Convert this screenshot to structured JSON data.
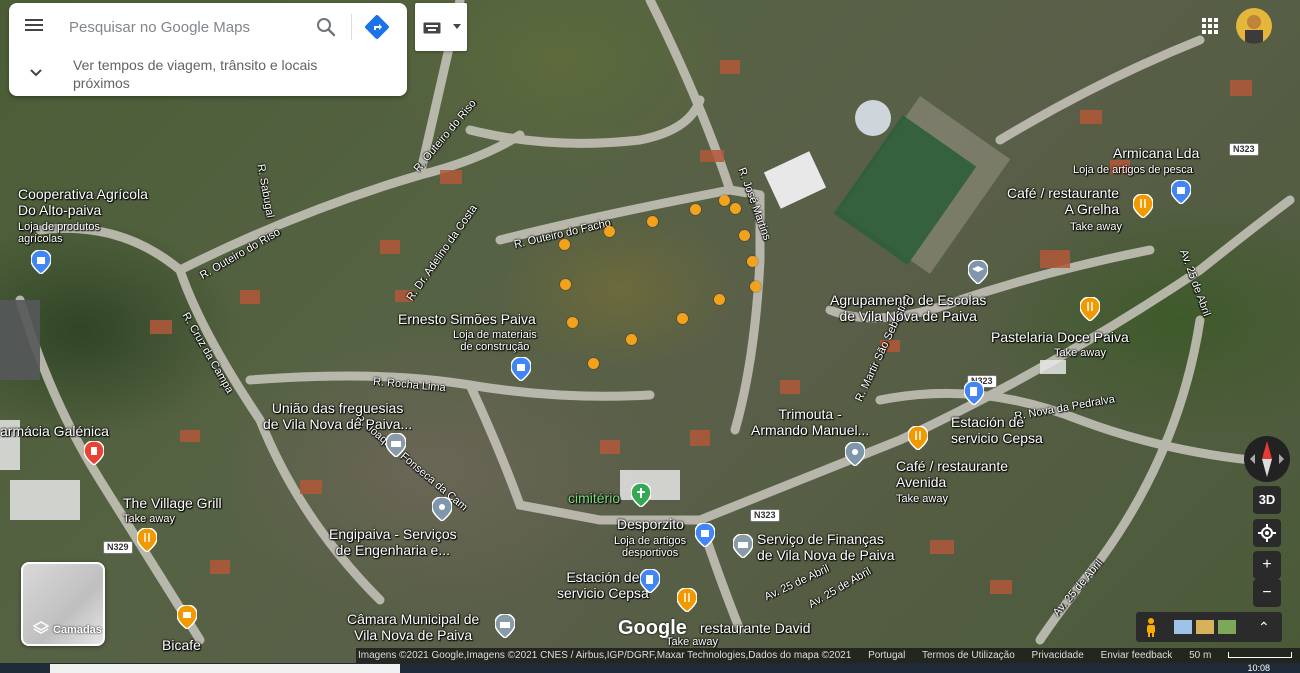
{
  "search": {
    "placeholder": "Pesquisar no Google Maps",
    "nearby_text": "Ver tempos de viagem, trânsito e locais próximos"
  },
  "icons": {
    "menu": "hamburger-icon",
    "search": "search-icon",
    "directions": "directions-icon",
    "keyboard": "keyboard-icon",
    "apps": "apps-grid-icon",
    "layers": "layers-icon",
    "pegman": "pegman-icon"
  },
  "layers": {
    "label": "Camadas"
  },
  "controls": {
    "three_d": "3D",
    "zoom_in": "+",
    "zoom_out": "−",
    "expand": "⌃"
  },
  "places": [
    {
      "name": "Cooperativa Agrícola\nDo Alto-paiva",
      "sub": "Loja de produtos\nagrícolas"
    },
    {
      "name": "Ernesto Simões Paiva",
      "sub": "Loja de materiais\nde construção"
    },
    {
      "name": "União das freguesias\nde Vila Nova de Paiva..."
    },
    {
      "name": "armácia Galénica"
    },
    {
      "name": "The Village Grill",
      "sub": "Take away"
    },
    {
      "name": "Engipaiva - Serviços\nde Engenharia e..."
    },
    {
      "name": "Câmara Municipal de\nVila Nova de Paiva"
    },
    {
      "name": "Bicafe"
    },
    {
      "name": "cimitério"
    },
    {
      "name": "Desporzito",
      "sub": "Loja de artigos\ndesportivos"
    },
    {
      "name": "Estación de\nservicio Cepsa"
    },
    {
      "name": "Serviço de Finanças\nde Vila Nova de Paiva"
    },
    {
      "name": "restaurante David",
      "sub": "Take away"
    },
    {
      "name": "Trimouta -\nArmando Manuel..."
    },
    {
      "name": "Agrupamento de Escolas\nde Vila Nova de Paiva"
    },
    {
      "name": "Pastelaria Doce Paiva",
      "sub": "Take away"
    },
    {
      "name": "Estación de\nservicio Cepsa"
    },
    {
      "name": "Café / restaurante\nAvenida",
      "sub": "Take away"
    },
    {
      "name": "Café / restaurante\nA Grelha",
      "sub": "Take away"
    },
    {
      "name": "Armicana Lda",
      "sub": "Loja de artigos de pesca"
    }
  ],
  "roads": [
    "R. Outeiro do Riso",
    "R. Sabugal",
    "R. Outeiro do Riso",
    "R. Dr. Adelino da Costa",
    "R. Outeiro do Facho",
    "R. José Martins",
    "R. Rocha Lima",
    "R. Cruz da Campa",
    "R. Martir São Sebastião",
    "R. Nova da Pedralva",
    "Av. 25 de Abril",
    "Av. 25 de Abril",
    "Av. 25 de Abril",
    "R. Joaquim Fonseca da Cam",
    "Av. 25 de Abril"
  ],
  "shields": [
    "N323",
    "N323",
    "N323",
    "N329"
  ],
  "attribution": {
    "imagery": "Imagens ©2021 Google,Imagens ©2021 CNES / Airbus,IGP/DGRF,Maxar Technologies,Dados do mapa ©2021",
    "country": "Portugal",
    "terms": "Termos de Utilização",
    "privacy": "Privacidade",
    "feedback": "Enviar feedback",
    "scale": "50 m"
  },
  "logo": "Google",
  "clock": "10:08"
}
